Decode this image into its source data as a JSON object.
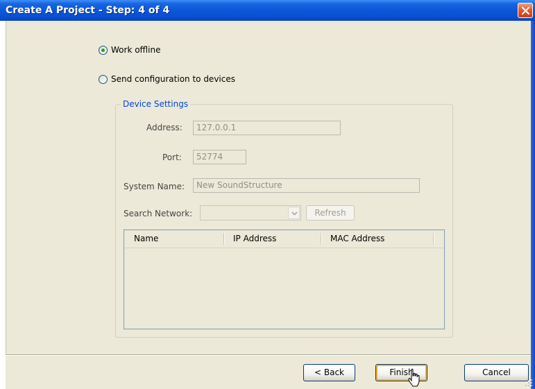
{
  "window": {
    "title": "Create A Project - Step: 4 of 4"
  },
  "options": {
    "work_offline": {
      "label": "Work offline",
      "selected": true
    },
    "send_config": {
      "label": "Send configuration to devices",
      "selected": false
    }
  },
  "device_settings": {
    "title": "Device Settings",
    "address_label": "Address:",
    "address_value": "127.0.0.1",
    "port_label": "Port:",
    "port_value": "52774",
    "system_name_label": "System Name:",
    "system_name_value": "New SoundStructure",
    "search_network_label": "Search Network:",
    "search_network_value": "",
    "refresh_label": "Refresh"
  },
  "device_list": {
    "columns": [
      "Name",
      "IP Address",
      "MAC Address"
    ],
    "rows": []
  },
  "footer": {
    "back_label": "< Back",
    "finish_label": "Finish",
    "cancel_label": "Cancel"
  },
  "colors": {
    "titlebar": "#0a58d8",
    "dialog_bg": "#ece9d8",
    "groupbox_title": "#0046d5",
    "radio_dot": "#21a121",
    "close_button": "#e2592e"
  }
}
